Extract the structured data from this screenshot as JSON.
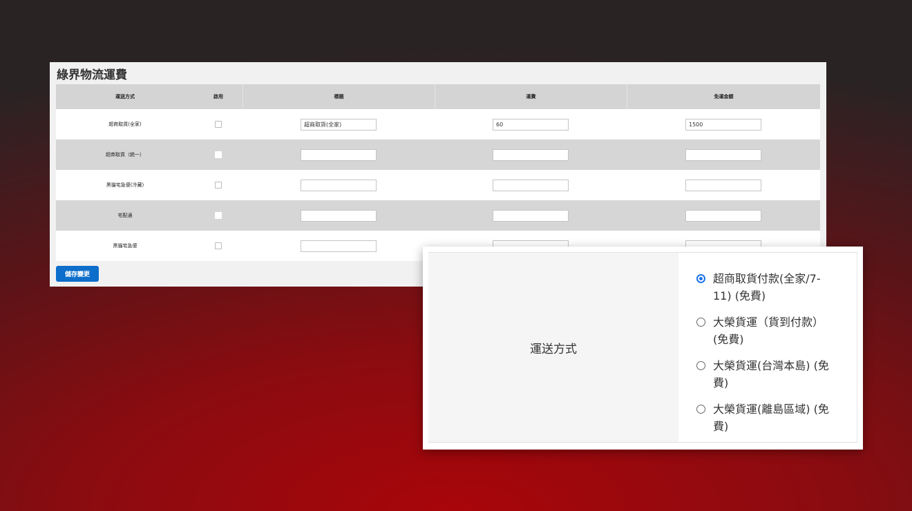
{
  "panel": {
    "title": "綠界物流運費",
    "columns": [
      "運送方式",
      "啟用",
      "標題",
      "運費",
      "免運金額"
    ],
    "rows": [
      {
        "method": "超商取貨(全家)",
        "title": "超商取貨(全家)",
        "fee": "60",
        "free_amount": "1500"
      },
      {
        "method": "超商取貨（統一）",
        "title": "",
        "fee": "",
        "free_amount": ""
      },
      {
        "method": "黑貓宅急便(冷藏)",
        "title": "",
        "fee": "",
        "free_amount": ""
      },
      {
        "method": "宅配通",
        "title": "",
        "fee": "",
        "free_amount": ""
      },
      {
        "method": "黑貓宅急便",
        "title": "",
        "fee": "",
        "free_amount": ""
      }
    ],
    "save_label": "儲存變更"
  },
  "shipping_popup": {
    "label": "運送方式",
    "options": [
      {
        "line1": "超商取貨付款(全家/7-",
        "line2": "11) (免費)",
        "selected": true
      },
      {
        "line1": "大榮貨運（貨到付款）",
        "line2": "(免費)",
        "selected": false
      },
      {
        "line1": "大榮貨運(台灣本島) (免",
        "line2": "費)",
        "selected": false
      },
      {
        "line1": "大榮貨運(離島區域) (免",
        "line2": "費)",
        "selected": false
      }
    ]
  },
  "colors": {
    "accent": "#0d6ecb",
    "radio_selected": "#1a73e8",
    "background_red": "#a8050a"
  }
}
